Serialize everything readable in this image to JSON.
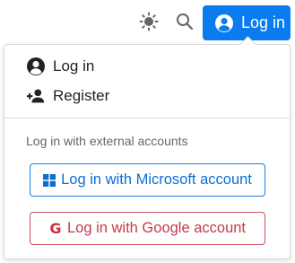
{
  "header": {
    "theme_icon": "sun-icon",
    "search_icon": "search-icon",
    "login_button": {
      "label": "Log in",
      "icon": "user-circle-icon",
      "color": "#0a7cf0"
    }
  },
  "dropdown": {
    "items": [
      {
        "label": "Log in",
        "icon": "user-circle-icon"
      },
      {
        "label": "Register",
        "icon": "user-plus-icon"
      }
    ],
    "external_section_label": "Log in with external accounts",
    "external_buttons": [
      {
        "label": "Log in with Microsoft account",
        "icon": "windows-icon",
        "color": "#0b6fd6"
      },
      {
        "label": "Log in with Google account",
        "icon": "google-icon",
        "color": "#c23b48"
      }
    ]
  }
}
